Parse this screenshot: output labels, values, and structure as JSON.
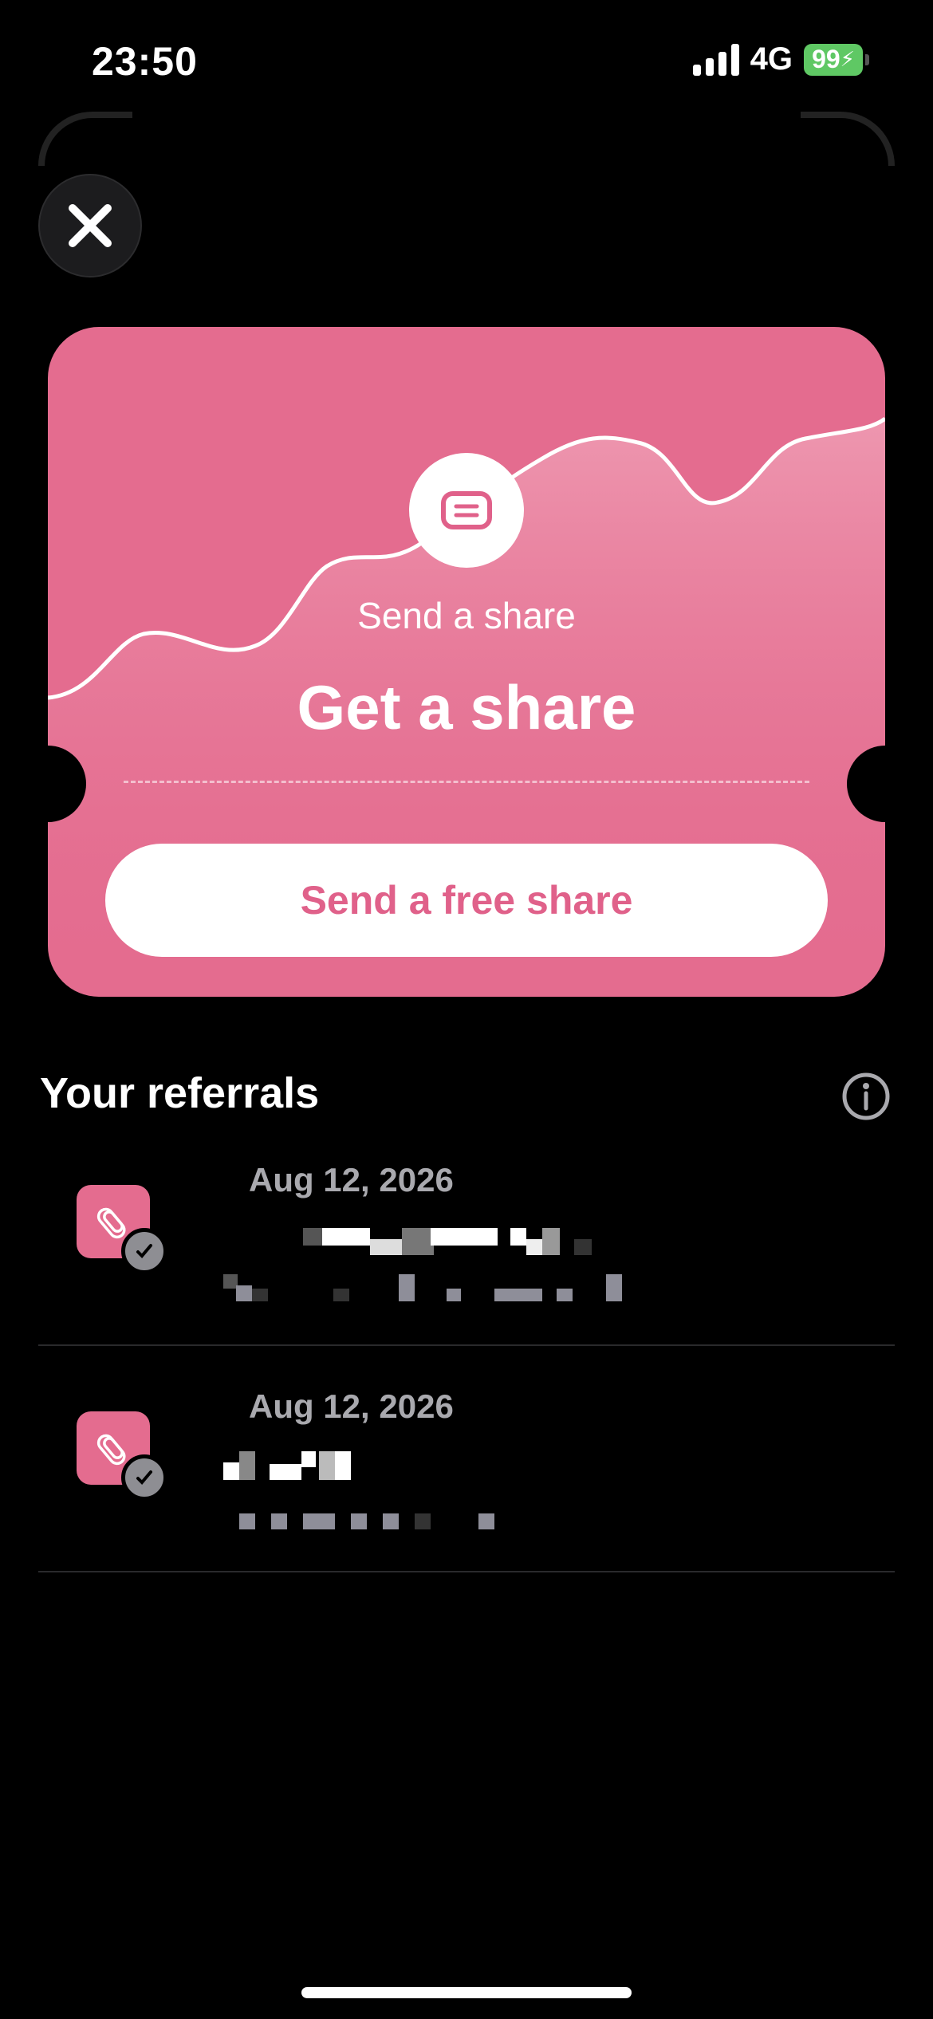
{
  "status_bar": {
    "time": "23:50",
    "network": "4G",
    "battery": "99"
  },
  "card": {
    "subtitle": "Send a share",
    "title": "Get a share",
    "button_label": "Send a free share",
    "accent_color": "#e46c8f"
  },
  "referrals": {
    "heading": "Your referrals",
    "items": [
      {
        "date": "Aug 12, 2026"
      },
      {
        "date": "Aug 12, 2026"
      }
    ]
  },
  "icons": {
    "close": "close-icon",
    "card": "ticket-icon",
    "info": "info-icon",
    "referral": "paperclip-icon",
    "status": "check-icon"
  }
}
